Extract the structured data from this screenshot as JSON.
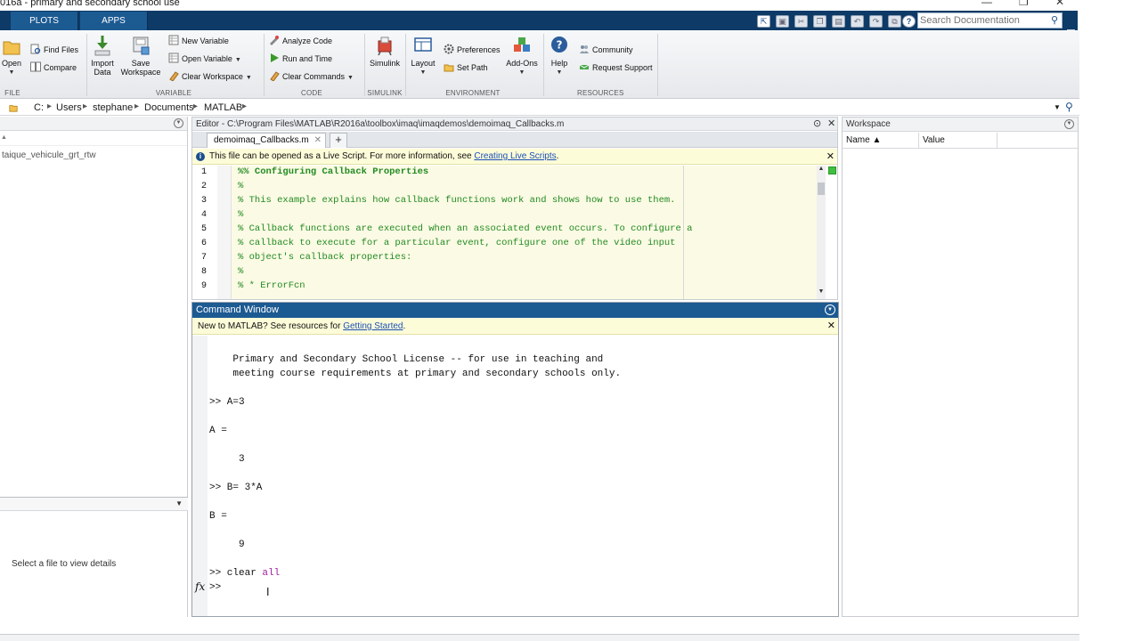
{
  "window": {
    "title": "016a - primary and secondary school use",
    "controls": {
      "minimize": "—",
      "maximize": "❐",
      "close": "✕"
    }
  },
  "tabs": [
    {
      "label": "PLOTS"
    },
    {
      "label": "APPS"
    }
  ],
  "doc_search": {
    "placeholder": "Search Documentation"
  },
  "toolstrip": {
    "file": {
      "label": "FILE",
      "open": "Open",
      "find_files": "Find Files",
      "compare": "Compare"
    },
    "variable": {
      "label": "VARIABLE",
      "import_data_1": "Import",
      "import_data_2": "Data",
      "save_workspace_1": "Save",
      "save_workspace_2": "Workspace",
      "new_variable": "New Variable",
      "open_variable": "Open Variable",
      "clear_workspace": "Clear Workspace"
    },
    "code": {
      "label": "CODE",
      "analyze_code": "Analyze Code",
      "run_and_time": "Run and Time",
      "clear_commands": "Clear Commands"
    },
    "simulink": {
      "label": "SIMULINK",
      "simulink": "Simulink"
    },
    "environment": {
      "label": "ENVIRONMENT",
      "layout": "Layout",
      "preferences": "Preferences",
      "set_path": "Set Path",
      "add_ons": "Add-Ons"
    },
    "resources": {
      "label": "RESOURCES",
      "help": "Help",
      "community": "Community",
      "request_support": "Request Support"
    }
  },
  "address_bar": {
    "crumbs": [
      "C:",
      "Users",
      "stephane",
      "Documents",
      "MATLAB"
    ]
  },
  "current_folder": {
    "item": "taique_vehicule_grt_rtw",
    "details_text": "Select a file to view details"
  },
  "editor": {
    "title": "Editor - C:\\Program Files\\MATLAB\\R2016a\\toolbox\\imaq\\imaqdemos\\demoimaq_Callbacks.m",
    "tab": "demoimaq_Callbacks.m",
    "info_text": "This file can be opened as a Live Script. For more information, see ",
    "info_link": "Creating Live Scripts",
    "info_end": ".",
    "lines": [
      {
        "num": "1",
        "code": "%% Configuring Callback Properties",
        "bold": true
      },
      {
        "num": "2",
        "code": "%",
        "bold": false
      },
      {
        "num": "3",
        "code": "% This example explains how callback functions work and shows how to use them.",
        "bold": false
      },
      {
        "num": "4",
        "code": "%",
        "bold": false
      },
      {
        "num": "5",
        "code": "% Callback functions are executed when an associated event occurs. To configure a",
        "bold": false
      },
      {
        "num": "6",
        "code": "% callback to execute for a particular event, configure one of the video input",
        "bold": false
      },
      {
        "num": "7",
        "code": "% object's callback properties:",
        "bold": false
      },
      {
        "num": "8",
        "code": "%",
        "bold": false
      },
      {
        "num": "9",
        "code": "% * ErrorFcn",
        "bold": false
      }
    ]
  },
  "command_window": {
    "title": "Command Window",
    "info_text": "New to MATLAB? See resources for ",
    "info_link": "Getting Started",
    "info_end": ".",
    "lines": [
      {
        "text": "    Primary and Secondary School License -- for use in teaching and"
      },
      {
        "text": "    meeting course requirements at primary and secondary schools only."
      },
      {
        "text": ">> A=3"
      },
      {
        "text": "A ="
      },
      {
        "text": "     3"
      },
      {
        "text": ">> B= 3*A"
      },
      {
        "text": "B ="
      },
      {
        "text": "     9"
      },
      {
        "text": ">> clear ",
        "keyword": "all"
      },
      {
        "text": ">> "
      }
    ],
    "fx": "fx"
  },
  "workspace": {
    "title": "Workspace",
    "col_name": "Name ▲",
    "col_value": "Value"
  },
  "colors": {
    "tab_bar": "#0d3a66",
    "tab": "#1c5a92",
    "comment": "#228b22",
    "keyword": "#a020a0",
    "link": "#1a4fb5",
    "info_bg": "#fdfcd9"
  }
}
